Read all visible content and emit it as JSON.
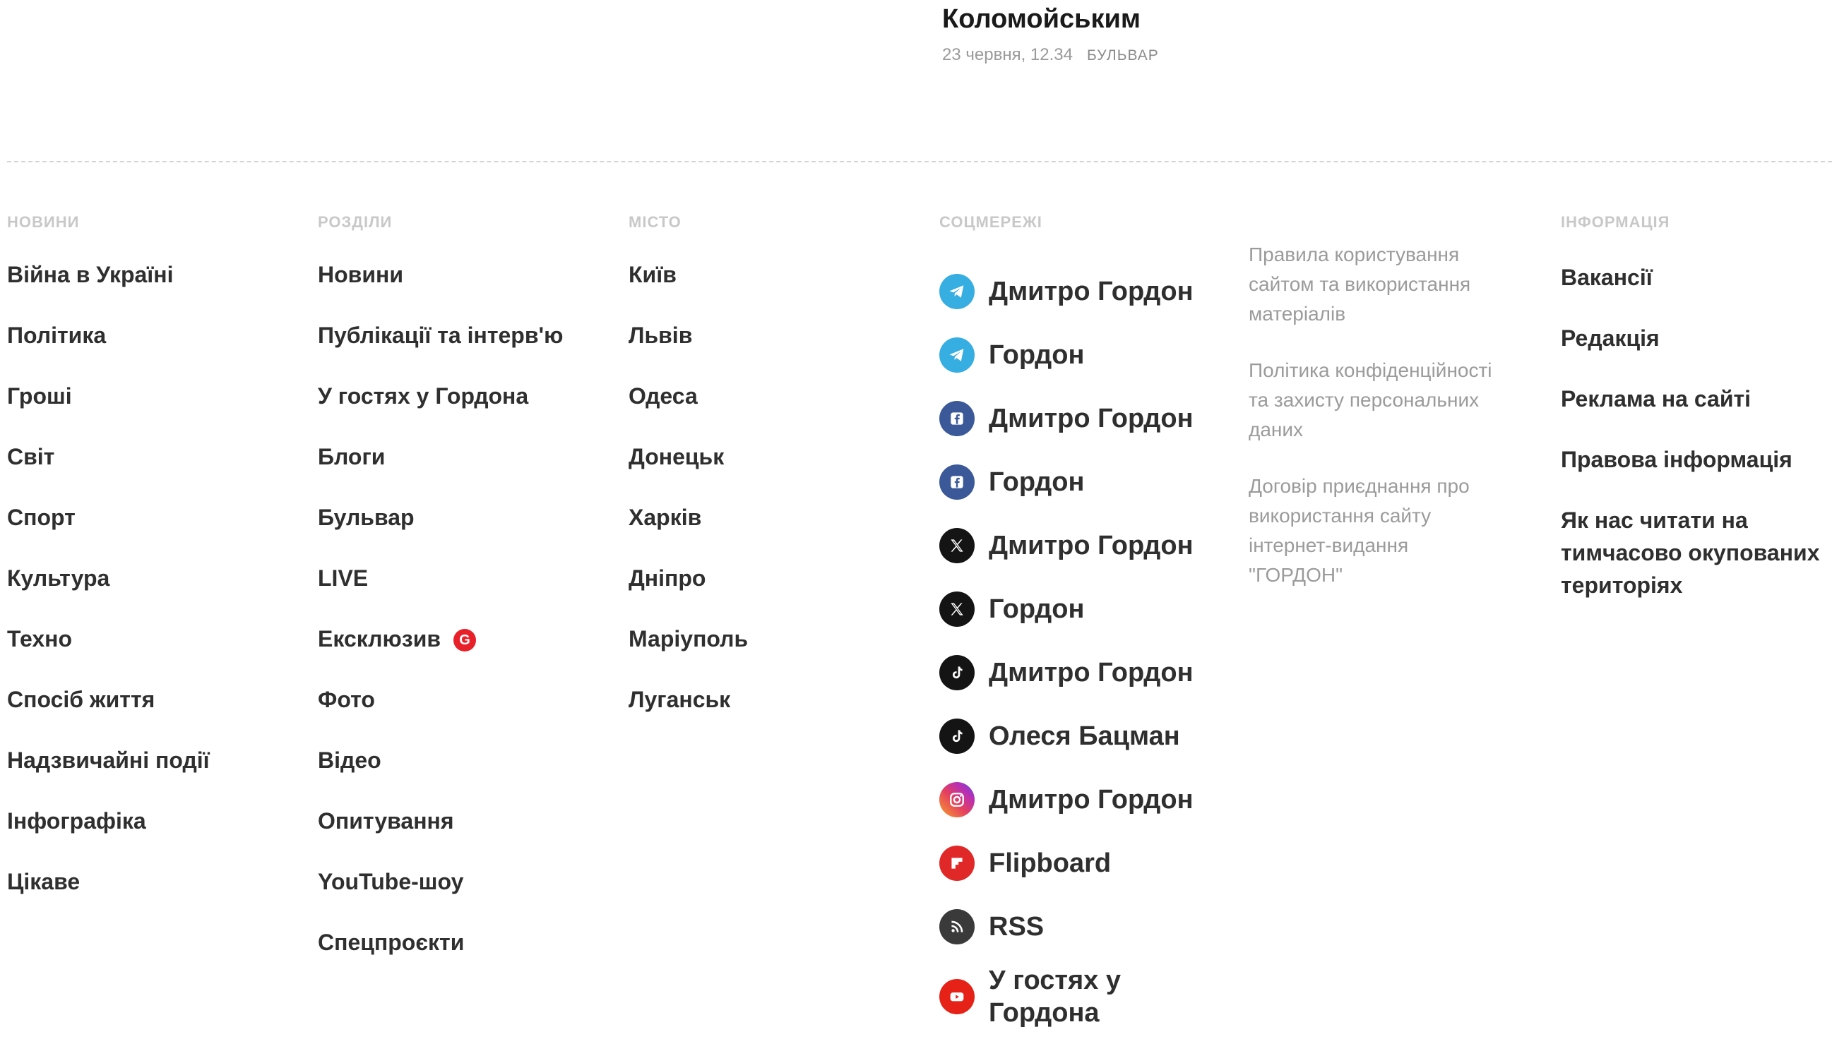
{
  "article": {
    "title": "Коломойським",
    "date": "23 червня, 12.34",
    "category": "БУЛЬВАР"
  },
  "footer": {
    "news": {
      "heading": "НОВИНИ",
      "items": [
        "Війна в Україні",
        "Політика",
        "Гроші",
        "Світ",
        "Спорт",
        "Культура",
        "Техно",
        "Спосіб життя",
        "Надзвичайні події",
        "Інфографіка",
        "Цікаве"
      ]
    },
    "sections": {
      "heading": "РОЗДІЛИ",
      "items": [
        "Новини",
        "Публікації та інтерв'ю",
        "У гостях у Гордона",
        "Блоги",
        "Бульвар",
        "LIVE",
        "Ексклюзив",
        "Фото",
        "Відео",
        "Опитування",
        "YouTube-шоу",
        "Спецпроєкти"
      ],
      "exclusive_badge": "G"
    },
    "city": {
      "heading": "МІСТО",
      "items": [
        "Київ",
        "Львів",
        "Одеса",
        "Донецьк",
        "Харків",
        "Дніпро",
        "Маріуполь",
        "Луганськ"
      ]
    },
    "social": {
      "heading": "СОЦМЕРЕЖІ",
      "items": [
        {
          "icon": "telegram-icon",
          "label": "Дмитро Гордон"
        },
        {
          "icon": "telegram-icon",
          "label": "Гордон"
        },
        {
          "icon": "facebook-icon",
          "label": "Дмитро Гордон"
        },
        {
          "icon": "facebook-icon",
          "label": "Гордон"
        },
        {
          "icon": "x-icon",
          "label": "Дмитро Гордон"
        },
        {
          "icon": "x-icon",
          "label": "Гордон"
        },
        {
          "icon": "tiktok-icon",
          "label": "Дмитро Гордон"
        },
        {
          "icon": "tiktok-icon",
          "label": "Олеся Бацман"
        },
        {
          "icon": "instagram-icon",
          "label": "Дмитро Гордон"
        },
        {
          "icon": "flipboard-icon",
          "label": "Flipboard"
        },
        {
          "icon": "rss-icon",
          "label": "RSS"
        },
        {
          "icon": "youtube-icon",
          "label": "У гостях у Гордона"
        }
      ]
    },
    "legal": {
      "items": [
        "Правила користування сайтом та використання матеріалів",
        "Політика конфіденційності та захисту персональних даних",
        "Договір приєднання про використання сайту інтернет-видання \"ГОРДОН\""
      ]
    },
    "info": {
      "heading": "ІНФОРМАЦІЯ",
      "items": [
        "Вакансії",
        "Редакція",
        "Реклама на сайті",
        "Правова інформація",
        "Як нас читати на тимчасово окупованих територіях"
      ]
    }
  },
  "colors": {
    "text": "#2f2f2f",
    "muted": "#9b9b9b",
    "heading": "#c8c8c8",
    "badge": "#e8202a"
  }
}
